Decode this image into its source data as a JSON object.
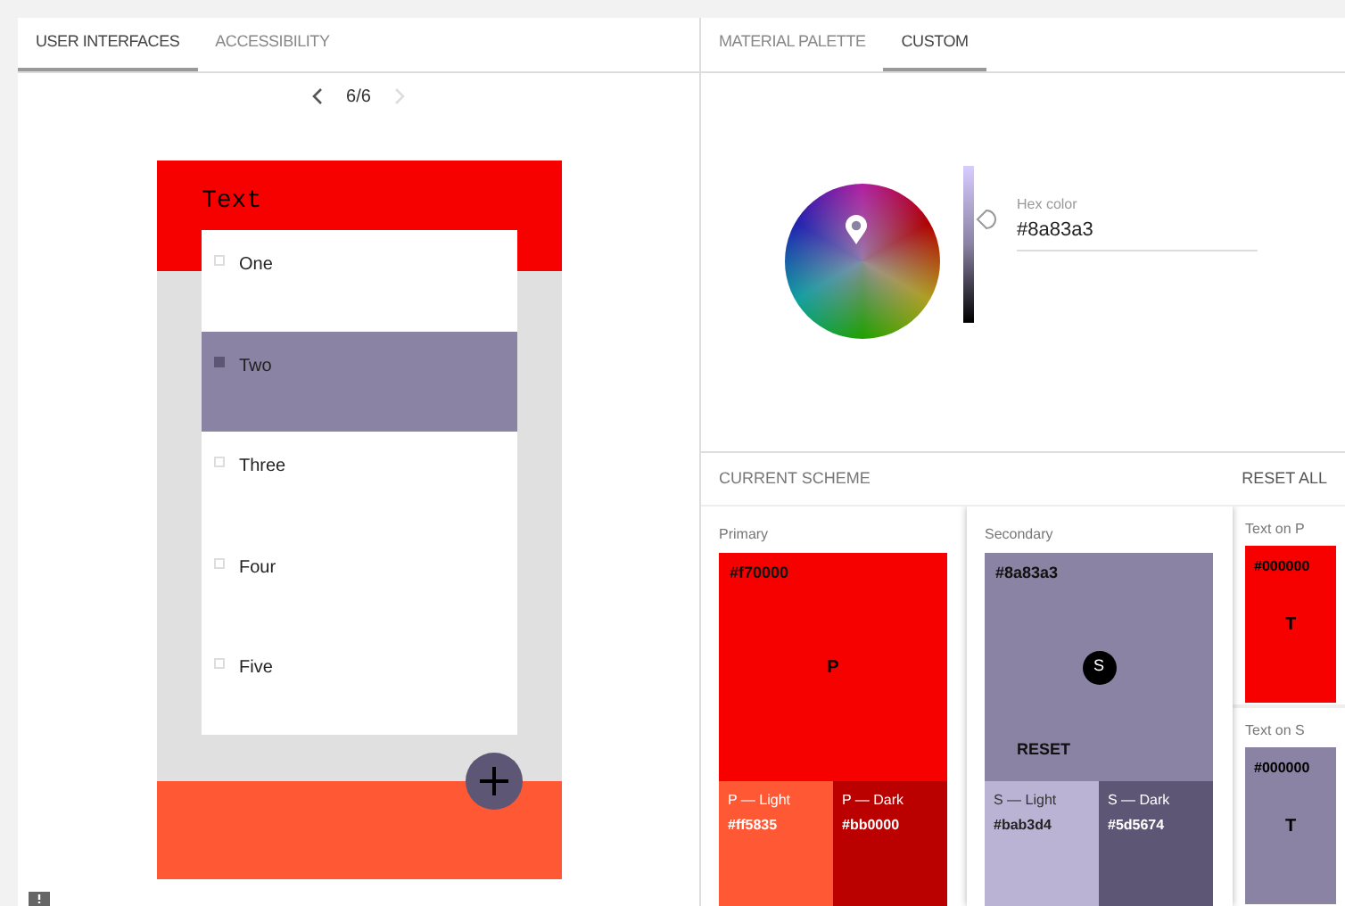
{
  "left_tabs": [
    {
      "label": "USER INTERFACES",
      "selected": true
    },
    {
      "label": "ACCESSIBILITY",
      "selected": false
    }
  ],
  "pager": {
    "page": "6/6",
    "next_disabled": true
  },
  "phone": {
    "app_bar_title": "Text",
    "items": [
      {
        "label": "One",
        "selected": false
      },
      {
        "label": "Two",
        "selected": true
      },
      {
        "label": "Three",
        "selected": false
      },
      {
        "label": "Four",
        "selected": false
      },
      {
        "label": "Five",
        "selected": false
      }
    ]
  },
  "right_tabs": [
    {
      "label": "MATERIAL PALETTE",
      "selected": false
    },
    {
      "label": "CUSTOM",
      "selected": true
    }
  ],
  "picker": {
    "lightness": {
      "level": 0.66
    },
    "hex_label": "Hex color",
    "hex_value": "#8a83a3"
  },
  "scheme": {
    "title": "CURRENT SCHEME",
    "reset_all": "RESET ALL",
    "primary": {
      "label": "Primary",
      "hex": "#f70000",
      "letter": "P",
      "light": {
        "label": "P — Light",
        "hex": "#ff5835"
      },
      "dark": {
        "label": "P — Dark",
        "hex": "#bb0000"
      }
    },
    "secondary": {
      "label": "Secondary",
      "hex": "#8a83a3",
      "letter": "S",
      "reset": "RESET",
      "light": {
        "label": "S — Light",
        "hex": "#bab3d4"
      },
      "dark": {
        "label": "S — Dark",
        "hex": "#5d5674"
      }
    },
    "text_on": [
      {
        "label": "Text on P",
        "hex": "#000000",
        "letter": "T",
        "color": "#f70000"
      },
      {
        "label": "Text on S",
        "hex": "#000000",
        "letter": "T",
        "color": "#8a83a3"
      }
    ]
  }
}
